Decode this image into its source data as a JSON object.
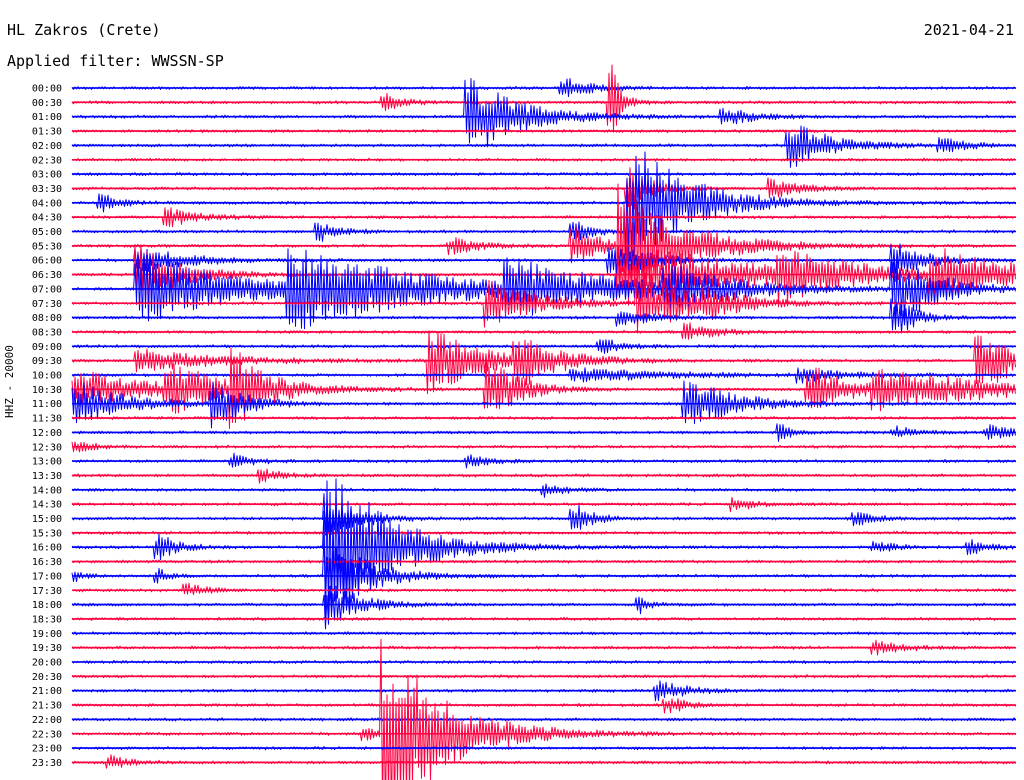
{
  "header": {
    "station": "HL Zakros (Crete)",
    "date": "2021-04-21",
    "filter": "Applied filter: WWSSN-SP"
  },
  "axis": {
    "channel_label": "HHZ - 20000"
  },
  "colors": {
    "even": "#0000ff",
    "odd": "#ff0040"
  },
  "chart_data": {
    "type": "line",
    "title": "HL Zakros (Crete)",
    "subtitle": "Applied filter: WWSSN-SP",
    "ylabel": "HHZ - 20000",
    "xlabel": "",
    "ylim": [
      "00:00",
      "23:30"
    ],
    "grid": false,
    "series": [
      {
        "row": "00:00",
        "events": [
          {
            "t": 0.52,
            "a": 0.6,
            "d": 0.03
          }
        ]
      },
      {
        "row": "00:30",
        "events": [
          {
            "t": 0.33,
            "a": 0.5,
            "d": 0.02
          },
          {
            "t": 0.57,
            "a": 2.5,
            "d": 0.01
          }
        ]
      },
      {
        "row": "01:00",
        "events": [
          {
            "t": 0.42,
            "a": 2.5,
            "d": 0.05
          },
          {
            "t": 0.69,
            "a": 0.5,
            "d": 0.03
          }
        ]
      },
      {
        "row": "01:30",
        "events": []
      },
      {
        "row": "02:00",
        "events": [
          {
            "t": 0.76,
            "a": 1.5,
            "d": 0.04
          },
          {
            "t": 0.92,
            "a": 0.4,
            "d": 0.03
          }
        ]
      },
      {
        "row": "02:30",
        "events": []
      },
      {
        "row": "03:00",
        "events": []
      },
      {
        "row": "03:30",
        "events": [
          {
            "t": 0.59,
            "a": 1.5,
            "d": 0.02
          },
          {
            "t": 0.74,
            "a": 0.6,
            "d": 0.03
          }
        ]
      },
      {
        "row": "04:00",
        "events": [
          {
            "t": 0.59,
            "a": 4.0,
            "d": 0.06
          },
          {
            "t": 0.03,
            "a": 0.5,
            "d": 0.02
          }
        ]
      },
      {
        "row": "04:30",
        "events": [
          {
            "t": 0.1,
            "a": 0.6,
            "d": 0.03
          }
        ]
      },
      {
        "row": "05:00",
        "events": [
          {
            "t": 0.26,
            "a": 0.6,
            "d": 0.02
          },
          {
            "t": 0.53,
            "a": 0.6,
            "d": 0.02
          }
        ]
      },
      {
        "row": "05:30",
        "events": [
          {
            "t": 0.53,
            "a": 1.3,
            "d": 0.03
          },
          {
            "t": 0.58,
            "a": 4.0,
            "d": 0.06
          },
          {
            "t": 0.4,
            "a": 0.5,
            "d": 0.03
          }
        ]
      },
      {
        "row": "06:00",
        "events": [
          {
            "t": 0.07,
            "a": 0.8,
            "d": 0.05
          },
          {
            "t": 0.87,
            "a": 1.2,
            "d": 0.03
          },
          {
            "t": 0.57,
            "a": 1.0,
            "d": 0.04
          }
        ]
      },
      {
        "row": "06:30",
        "events": [
          {
            "t": 0.07,
            "a": 2.0,
            "d": 0.04
          },
          {
            "t": 0.58,
            "a": 2.0,
            "d": 0.14
          },
          {
            "t": 0.75,
            "a": 1.4,
            "d": 0.06
          },
          {
            "t": 0.91,
            "a": 1.5,
            "d": 0.09
          }
        ]
      },
      {
        "row": "07:00",
        "events": [
          {
            "t": 0.07,
            "a": 2.5,
            "d": 0.09
          },
          {
            "t": 0.23,
            "a": 2.5,
            "d": 0.13
          },
          {
            "t": 0.46,
            "a": 1.6,
            "d": 0.1
          },
          {
            "t": 0.63,
            "a": 1.2,
            "d": 0.06
          },
          {
            "t": 0.87,
            "a": 2.5,
            "d": 0.04
          }
        ]
      },
      {
        "row": "07:30",
        "events": [
          {
            "t": 0.44,
            "a": 1.5,
            "d": 0.05
          },
          {
            "t": 0.6,
            "a": 2.0,
            "d": 0.05
          },
          {
            "t": 0.67,
            "a": 0.6,
            "d": 0.04
          }
        ]
      },
      {
        "row": "08:00",
        "events": [
          {
            "t": 0.58,
            "a": 0.5,
            "d": 0.03
          },
          {
            "t": 0.87,
            "a": 1.3,
            "d": 0.02
          }
        ]
      },
      {
        "row": "08:30",
        "events": [
          {
            "t": 0.65,
            "a": 0.5,
            "d": 0.03
          }
        ]
      },
      {
        "row": "09:00",
        "events": [
          {
            "t": 0.56,
            "a": 0.5,
            "d": 0.02
          }
        ]
      },
      {
        "row": "09:30",
        "events": [
          {
            "t": 0.07,
            "a": 0.7,
            "d": 0.08
          },
          {
            "t": 0.38,
            "a": 2.0,
            "d": 0.05
          },
          {
            "t": 0.47,
            "a": 1.5,
            "d": 0.04
          },
          {
            "t": 0.96,
            "a": 2.0,
            "d": 0.04
          }
        ]
      },
      {
        "row": "10:00",
        "events": [
          {
            "t": 0.53,
            "a": 0.4,
            "d": 0.1
          },
          {
            "t": 0.77,
            "a": 0.4,
            "d": 0.05
          }
        ]
      },
      {
        "row": "10:30",
        "events": [
          {
            "t": 0.0,
            "a": 1.3,
            "d": 0.08
          },
          {
            "t": 0.1,
            "a": 1.3,
            "d": 0.06
          },
          {
            "t": 0.17,
            "a": 2.2,
            "d": 0.03
          },
          {
            "t": 0.44,
            "a": 2.0,
            "d": 0.03
          },
          {
            "t": 0.78,
            "a": 1.6,
            "d": 0.04
          },
          {
            "t": 0.85,
            "a": 1.2,
            "d": 0.14
          }
        ]
      },
      {
        "row": "11:00",
        "events": [
          {
            "t": 0.0,
            "a": 1.5,
            "d": 0.05
          },
          {
            "t": 0.15,
            "a": 1.5,
            "d": 0.03
          },
          {
            "t": 0.65,
            "a": 1.5,
            "d": 0.05
          }
        ]
      },
      {
        "row": "11:30",
        "events": []
      },
      {
        "row": "12:00",
        "events": [
          {
            "t": 0.75,
            "a": 0.5,
            "d": 0.01
          },
          {
            "t": 0.87,
            "a": 0.4,
            "d": 0.02
          },
          {
            "t": 0.97,
            "a": 0.4,
            "d": 0.03
          }
        ]
      },
      {
        "row": "12:30",
        "events": [
          {
            "t": 0.0,
            "a": 0.4,
            "d": 0.02
          }
        ]
      },
      {
        "row": "13:00",
        "events": [
          {
            "t": 0.17,
            "a": 0.4,
            "d": 0.02
          },
          {
            "t": 0.42,
            "a": 0.4,
            "d": 0.02
          }
        ]
      },
      {
        "row": "13:30",
        "events": [
          {
            "t": 0.2,
            "a": 0.4,
            "d": 0.02
          }
        ]
      },
      {
        "row": "14:00",
        "events": [
          {
            "t": 0.5,
            "a": 0.4,
            "d": 0.02
          }
        ]
      },
      {
        "row": "14:30",
        "events": [
          {
            "t": 0.7,
            "a": 0.4,
            "d": 0.02
          }
        ]
      },
      {
        "row": "15:00",
        "events": [
          {
            "t": 0.27,
            "a": 1.5,
            "d": 0.03
          },
          {
            "t": 0.53,
            "a": 0.9,
            "d": 0.02
          },
          {
            "t": 0.83,
            "a": 0.4,
            "d": 0.02
          }
        ]
      },
      {
        "row": "15:30",
        "events": []
      },
      {
        "row": "16:00",
        "events": [
          {
            "t": 0.09,
            "a": 0.8,
            "d": 0.02
          },
          {
            "t": 0.27,
            "a": 5.5,
            "d": 0.06
          },
          {
            "t": 0.85,
            "a": 0.4,
            "d": 0.02
          },
          {
            "t": 0.95,
            "a": 0.4,
            "d": 0.02
          }
        ]
      },
      {
        "row": "16:30",
        "events": []
      },
      {
        "row": "17:00",
        "events": [
          {
            "t": 0.0,
            "a": 0.4,
            "d": 0.01
          },
          {
            "t": 0.09,
            "a": 0.4,
            "d": 0.01
          },
          {
            "t": 0.27,
            "a": 2.5,
            "d": 0.04
          }
        ]
      },
      {
        "row": "17:30",
        "events": [
          {
            "t": 0.12,
            "a": 0.4,
            "d": 0.02
          }
        ]
      },
      {
        "row": "18:00",
        "events": [
          {
            "t": 0.27,
            "a": 1.5,
            "d": 0.03
          },
          {
            "t": 0.6,
            "a": 0.5,
            "d": 0.01
          }
        ]
      },
      {
        "row": "18:30",
        "events": []
      },
      {
        "row": "19:00",
        "events": []
      },
      {
        "row": "19:30",
        "events": [
          {
            "t": 0.85,
            "a": 0.4,
            "d": 0.03
          }
        ]
      },
      {
        "row": "20:00",
        "events": []
      },
      {
        "row": "20:30",
        "events": []
      },
      {
        "row": "21:00",
        "events": [
          {
            "t": 0.62,
            "a": 0.6,
            "d": 0.03
          }
        ]
      },
      {
        "row": "21:30",
        "events": [
          {
            "t": 0.63,
            "a": 0.5,
            "d": 0.02
          }
        ]
      },
      {
        "row": "22:00",
        "events": []
      },
      {
        "row": "22:30",
        "events": [
          {
            "t": 0.33,
            "a": 6.0,
            "d": 0.06
          },
          {
            "t": 0.31,
            "a": 0.4,
            "d": 0.02
          }
        ]
      },
      {
        "row": "23:00",
        "events": []
      },
      {
        "row": "23:30",
        "events": [
          {
            "t": 0.04,
            "a": 0.4,
            "d": 0.02
          }
        ]
      }
    ]
  }
}
